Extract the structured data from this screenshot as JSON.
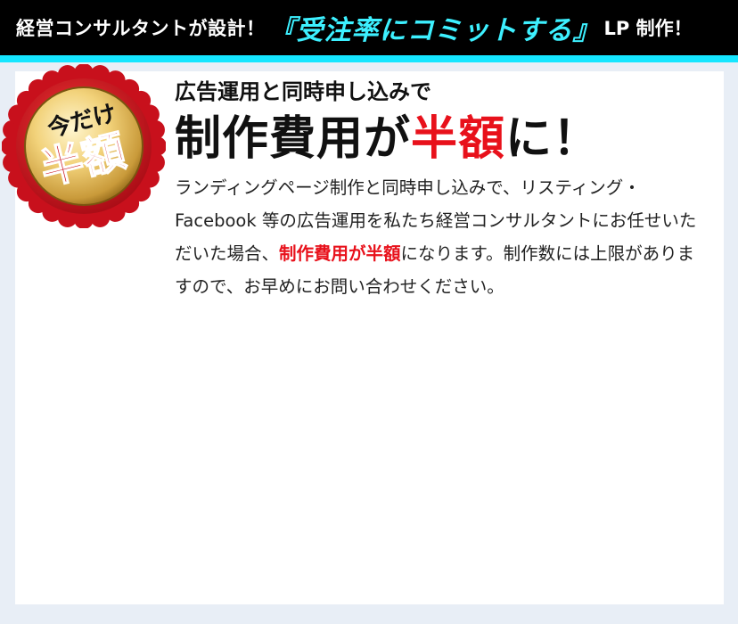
{
  "header": {
    "lead": "経営コンサルタントが設計！",
    "highlight": "『受注率にコミットする』",
    "tail": "LP 制作！"
  },
  "badge": {
    "top_text": "今だけ",
    "main_text": "半額",
    "colors": {
      "rosette": "#c8101c",
      "gold": "#f2d27a",
      "text": "#c8101c"
    }
  },
  "content": {
    "intro": "広告運用と同時申し込みで",
    "headline_before": "制作費用が",
    "headline_accent": "半額",
    "headline_after": "に！",
    "body_part1": "ランディングページ制作と同時申し込みで、リスティング・Facebook 等の広告運用を私たち経営コンサルタントにお任せいただいた場合、",
    "body_emphasis": "制作費用が半額",
    "body_part2": "になります。制作数には上限がありますので、お早めにお問い合わせください。"
  },
  "colors": {
    "header_bg": "#000000",
    "header_accent": "#3df0ff",
    "accent_line": "#15e6ff",
    "emphasis_red": "#e8111b",
    "page_bg": "#e8eef6"
  }
}
